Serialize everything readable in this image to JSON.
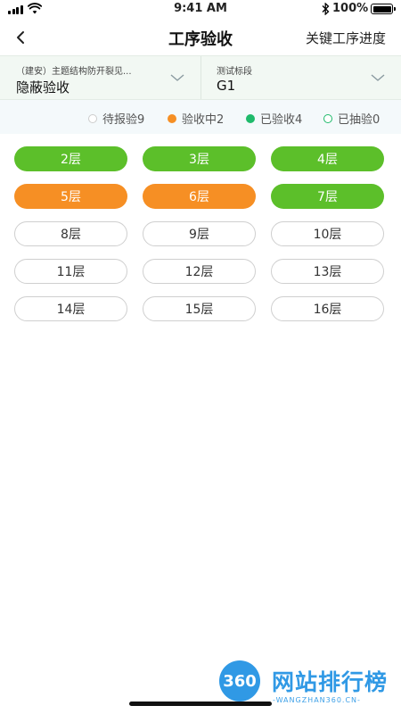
{
  "status_bar": {
    "time": "9:41 AM",
    "battery": "100%"
  },
  "nav": {
    "title": "工序验收",
    "right_action": "关键工序进度"
  },
  "filters": {
    "project": {
      "label": "（建安）主题结构防开裂见...",
      "value": "隐蔽验收"
    },
    "section": {
      "label": "测试标段",
      "value": "G1"
    }
  },
  "legend": [
    {
      "label": "待报验9",
      "color": "#ffffff",
      "border": "#cccccc"
    },
    {
      "label": "验收中2",
      "color": "#f68f24",
      "border": "#f68f24"
    },
    {
      "label": "已验收4",
      "color": "#1fba6b",
      "border": "#1fba6b"
    },
    {
      "label": "已抽验0",
      "color": "#ffffff",
      "border": "#1fba6b"
    }
  ],
  "floors": [
    {
      "label": "2层",
      "status": "done"
    },
    {
      "label": "3层",
      "status": "done"
    },
    {
      "label": "4层",
      "status": "done"
    },
    {
      "label": "5层",
      "status": "inprogress"
    },
    {
      "label": "6层",
      "status": "inprogress"
    },
    {
      "label": "7层",
      "status": "done"
    },
    {
      "label": "8层",
      "status": "pending"
    },
    {
      "label": "9层",
      "status": "pending"
    },
    {
      "label": "10层",
      "status": "pending"
    },
    {
      "label": "11层",
      "status": "pending"
    },
    {
      "label": "12层",
      "status": "pending"
    },
    {
      "label": "13层",
      "status": "pending"
    },
    {
      "label": "14层",
      "status": "pending"
    },
    {
      "label": "15层",
      "status": "pending"
    },
    {
      "label": "16层",
      "status": "pending"
    }
  ],
  "watermark": {
    "badge": "360",
    "text": "网站排行榜",
    "sub": "-WANGZHAN360.CN-"
  },
  "colors": {
    "done": "#5cbf2a",
    "inprogress": "#f68f24",
    "accent": "#1fba6b"
  }
}
